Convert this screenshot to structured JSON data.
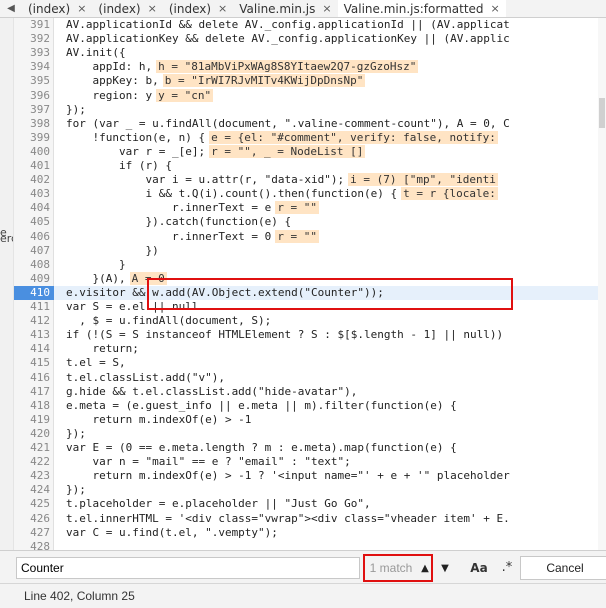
{
  "tabs": [
    {
      "label": "(index)",
      "active": false
    },
    {
      "label": "(index)",
      "active": false
    },
    {
      "label": "(index)",
      "active": false
    },
    {
      "label": "Valine.min.js",
      "active": false
    },
    {
      "label": "Valine.min.js:formatted",
      "active": true
    }
  ],
  "tab_close_glyph": "×",
  "left_stubs": [
    "e",
    "erc"
  ],
  "code_lines": [
    {
      "n": "391",
      "code": "AV.applicationId && delete AV._config.applicationId || (AV.applicat"
    },
    {
      "n": "392",
      "code": "AV.applicationKey && delete AV._config.applicationKey || (AV.applic"
    },
    {
      "n": "393",
      "code": "AV.init({"
    },
    {
      "n": "394",
      "code": "    appId: h,",
      "hint": "h = \"81aMbViPxWAg8S8YItaew2Q7-gzGzoHsz\""
    },
    {
      "n": "395",
      "code": "    appKey: b,",
      "hint": "b = \"IrWI7RJvMITv4KWijDpDnsNp\""
    },
    {
      "n": "396",
      "code": "    region: y",
      "hint": "y = \"cn\""
    },
    {
      "n": "397",
      "code": "});"
    },
    {
      "n": "398",
      "code": "for (var _ = u.findAll(document, \".valine-comment-count\"), A = 0, C"
    },
    {
      "n": "399",
      "code": "    !function(e, n) {",
      "hint": "e = {el: \"#comment\", verify: false, notify:"
    },
    {
      "n": "400",
      "code": "        var r = _[e];",
      "hint": "r = \"\", _ = NodeList []"
    },
    {
      "n": "401",
      "code": "        if (r) {"
    },
    {
      "n": "402",
      "code": "            var i = u.attr(r, \"data-xid\");",
      "hint": "i = (7) [\"mp\", \"identi"
    },
    {
      "n": "403",
      "code": "            i && t.Q(i).count().then(function(e) {",
      "hint": "t = r {locale:"
    },
    {
      "n": "404",
      "code": "                r.innerText = e",
      "hint": "r = \"\""
    },
    {
      "n": "405",
      "code": "            }).catch(function(e) {"
    },
    {
      "n": "406",
      "code": "                r.innerText = 0",
      "hint": "r = \"\""
    },
    {
      "n": "407",
      "code": "            })"
    },
    {
      "n": "408",
      "code": "        }"
    },
    {
      "n": "409",
      "code": "    }(A),",
      "hint": "A = 0"
    },
    {
      "n": "410",
      "code": "e.visitor && w.add(AV.Object.extend(\"Counter\"));",
      "current": true
    },
    {
      "n": "411",
      "code": "var S = e.el || null"
    },
    {
      "n": "412",
      "code": "  , $ = u.findAll(document, S);"
    },
    {
      "n": "413",
      "code": "if (!(S = S instanceof HTMLElement ? S : $[$.length - 1] || null))"
    },
    {
      "n": "414",
      "code": "    return;"
    },
    {
      "n": "415",
      "code": "t.el = S,"
    },
    {
      "n": "416",
      "code": "t.el.classList.add(\"v\"),"
    },
    {
      "n": "417",
      "code": "g.hide && t.el.classList.add(\"hide-avatar\"),"
    },
    {
      "n": "418",
      "code": "e.meta = (e.guest_info || e.meta || m).filter(function(e) {"
    },
    {
      "n": "419",
      "code": "    return m.indexOf(e) > -1"
    },
    {
      "n": "420",
      "code": "});"
    },
    {
      "n": "421",
      "code": "var E = (0 == e.meta.length ? m : e.meta).map(function(e) {"
    },
    {
      "n": "422",
      "code": "    var n = \"mail\" == e ? \"email\" : \"text\";"
    },
    {
      "n": "423",
      "code": "    return m.indexOf(e) > -1 ? '<input name=\"' + e + '\" placeholder"
    },
    {
      "n": "424",
      "code": "});"
    },
    {
      "n": "425",
      "code": "t.placeholder = e.placeholder || \"Just Go Go\","
    },
    {
      "n": "426",
      "code": "t.el.innerHTML = '<div class=\"vwrap\"><div class=\"vheader item' + E."
    },
    {
      "n": "427",
      "code": "var C = u.find(t.el, \".vempty\");"
    },
    {
      "n": "428",
      "code": ""
    }
  ],
  "search": {
    "value": "Counter",
    "match_count": "1 match",
    "up_glyph": "▲",
    "down_glyph": "▼",
    "case_label": "Aa",
    "regex_label": ".*",
    "cancel_label": "Cancel"
  },
  "status": {
    "position": "Line 402, Column 25"
  },
  "colors": {
    "current_line_number_bg": "#4a8fe0",
    "annotation_red": "#e01010",
    "hint_bg": "#ffe4c4"
  }
}
